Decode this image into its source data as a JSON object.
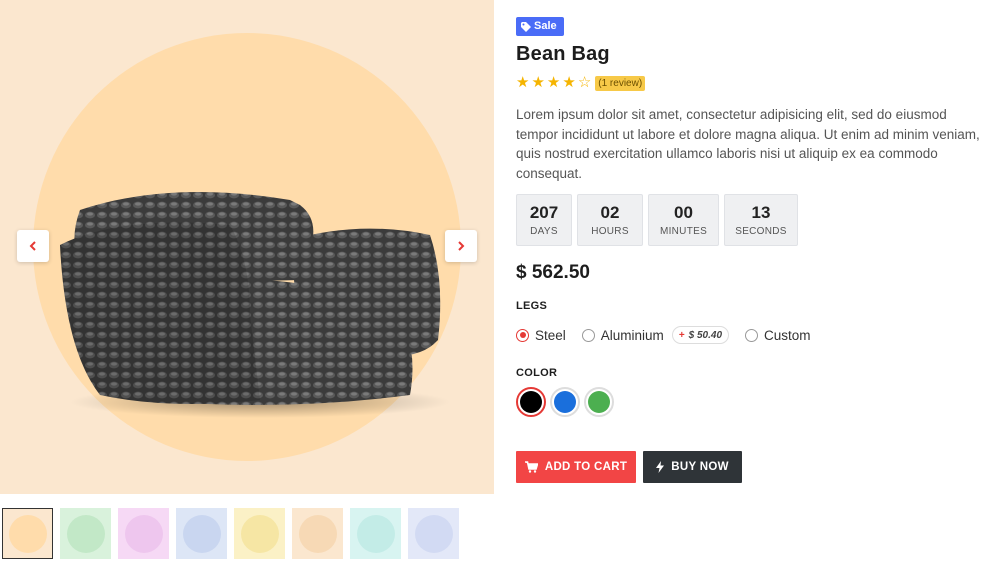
{
  "badge": {
    "label": "Sale",
    "color": "#4a6cf7"
  },
  "product": {
    "title": "Bean Bag",
    "review_text": "(1 review)",
    "rating": 4,
    "rating_max": 5,
    "description": "Lorem ipsum dolor sit amet, consectetur adipisicing elit, sed do eiusmod tempor incididunt ut labore et dolore magna aliqua. Ut enim ad minim veniam, quis nostrud exercitation ullamco laboris nisi ut aliquip ex ea commodo consequat.",
    "price": "$ 562.50"
  },
  "countdown": [
    {
      "value": "207",
      "label": "DAYS"
    },
    {
      "value": "02",
      "label": "HOURS"
    },
    {
      "value": "00",
      "label": "MINUTES"
    },
    {
      "value": "13",
      "label": "SECONDS"
    }
  ],
  "legs": {
    "label": "LEGS",
    "options": [
      {
        "label": "Steel",
        "checked": true
      },
      {
        "label": "Aluminium",
        "checked": false,
        "extra": "$ 50.40",
        "extra_sign": "+"
      },
      {
        "label": "Custom",
        "checked": false
      }
    ]
  },
  "color": {
    "label": "COLOR",
    "swatches": [
      {
        "name": "black",
        "hex": "#000000",
        "selected": true
      },
      {
        "name": "blue",
        "hex": "#1a6fdc",
        "selected": false
      },
      {
        "name": "green",
        "hex": "#4caf50",
        "selected": false
      }
    ]
  },
  "actions": {
    "add_to_cart": "ADD TO CART",
    "buy_now": "BUY NOW",
    "cart_color": "#f24545",
    "buy_color": "#2f3438"
  },
  "gallery": {
    "prev_icon": "chevron-left-icon",
    "next_icon": "chevron-right-icon",
    "thumbnails": [
      {
        "name": "black-bean-bag",
        "bg": "#fbe7cf",
        "circle": "#ffdcab",
        "active": true
      },
      {
        "name": "green-armchair",
        "bg": "#d9f2dc",
        "circle": "#c2e8c7",
        "active": false
      },
      {
        "name": "white-sofa",
        "bg": "#f6d9f5",
        "circle": "#eec6ee",
        "active": false
      },
      {
        "name": "grey-chair",
        "bg": "#dde6f6",
        "circle": "#c9d6f0",
        "active": false
      },
      {
        "name": "yellow-chair",
        "bg": "#fbf1c6",
        "circle": "#f6e6a4",
        "active": false
      },
      {
        "name": "wood-chair",
        "bg": "#fbe7cf",
        "circle": "#f7d9b5",
        "active": false
      },
      {
        "name": "lounge-chair",
        "bg": "#d8f4f1",
        "circle": "#c3ece7",
        "active": false
      },
      {
        "name": "black-shell-chair",
        "bg": "#e3e8f8",
        "circle": "#d2daf3",
        "active": false
      }
    ]
  }
}
